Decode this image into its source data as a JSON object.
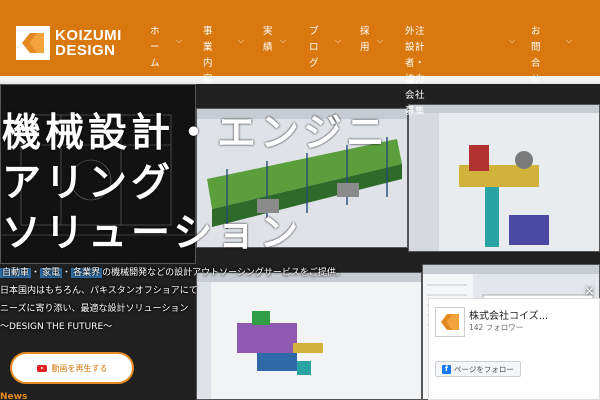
{
  "brand": {
    "line1": "KOIZUMI",
    "line2": "DESIGN",
    "color": "#d9780e"
  },
  "nav": [
    {
      "label": "ホーム",
      "lines": [
        "ホー",
        "ム"
      ]
    },
    {
      "label": "事業内容",
      "lines": [
        "事業内",
        "容"
      ]
    },
    {
      "label": "実績",
      "lines": [
        "実",
        "績"
      ]
    },
    {
      "label": "ブログ",
      "lines": [
        "ブロ",
        "グ"
      ]
    },
    {
      "label": "採用",
      "lines": [
        "採",
        "用"
      ]
    },
    {
      "label": "外注設計者・協力会社募集",
      "lines": [
        "外注設計者・協力会社",
        "募集"
      ]
    },
    {
      "label": "お問合せ",
      "lines": [
        "お問合",
        "せ"
      ]
    }
  ],
  "hero": {
    "title_lines": [
      "機械設計・エンジニ",
      "アリング",
      "ソリューション"
    ],
    "desc": {
      "chips": [
        "自動車",
        "家電",
        "各業界"
      ],
      "line1_rest": "の機械開発などの設計アウトソーシングサービスをご提供。",
      "line2": "日本国内はもちろん、パキスタンオフショアにて",
      "line3": "ニーズに寄り添い、最適な設計ソリューション",
      "line4": "～DESIGN THE FUTURE～"
    },
    "video_button": "動画を再生する"
  },
  "news_label": "News",
  "facebook": {
    "page_name": "株式会社コイズ...",
    "followers": "142 フォロワー",
    "follow_button": "ページをフォロー",
    "close": "×"
  }
}
